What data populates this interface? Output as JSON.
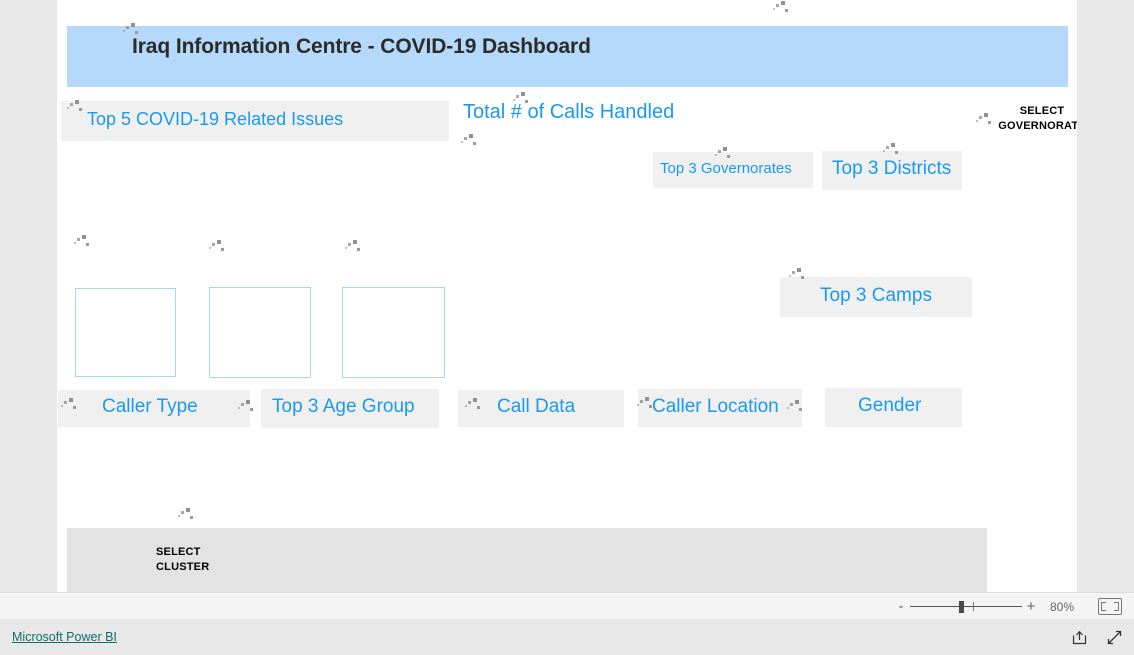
{
  "app": {
    "name": "Microsoft Power BI",
    "footer_link_label": "Microsoft Power BI"
  },
  "report": {
    "title": "Iraq Information Centre - COVID-19 Dashboard",
    "visuals": [
      {
        "id": "top5-issues",
        "label": "Top 5 COVID-19 Related Issues"
      },
      {
        "id": "total-calls",
        "label": "Total # of Calls Handled"
      },
      {
        "id": "top3-governorates",
        "label": "Top 3 Governorates"
      },
      {
        "id": "top3-districts",
        "label": "Top 3 Districts"
      },
      {
        "id": "top3-camps",
        "label": "Top 3 Camps"
      },
      {
        "id": "caller-type",
        "label": "Caller Type"
      },
      {
        "id": "top3-age-group",
        "label": "Top 3 Age Group"
      },
      {
        "id": "call-data",
        "label": "Call Data"
      },
      {
        "id": "caller-location",
        "label": "Caller Location"
      },
      {
        "id": "gender",
        "label": "Gender"
      }
    ],
    "slicers": [
      {
        "id": "select-governorate",
        "label": "SELECT\nGOVERNORATE"
      },
      {
        "id": "select-cluster",
        "label": "SELECT\nCLUSTER"
      }
    ],
    "loading": true
  },
  "status_bar": {
    "zoom_out_label": "-",
    "zoom_in_label": "+",
    "zoom_level": "80%",
    "fit_to_page_name": "fit-to-page-icon"
  },
  "colors": {
    "title_band": "#b4d9fa",
    "visual_title": "#1a99f3",
    "chart_outline": "#a8d8f0",
    "panel_bg": "#f0f0f0",
    "link": "#136d6d",
    "page_bg": "#ffffff",
    "shell_bg": "#e8e8e8"
  }
}
